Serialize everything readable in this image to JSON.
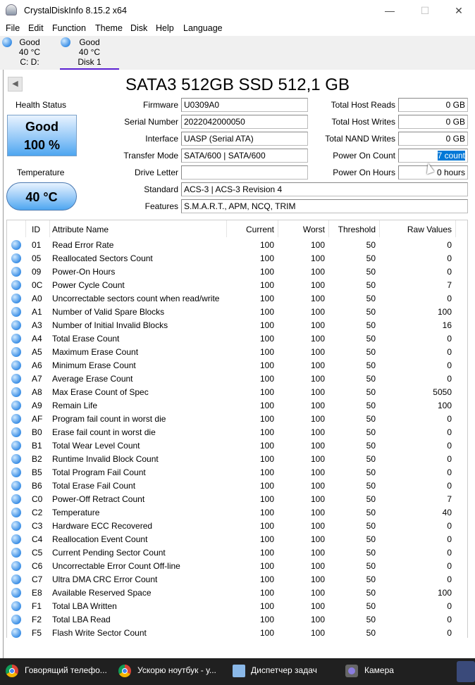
{
  "window": {
    "title": "CrystalDiskInfo 8.15.2 x64",
    "minimize": "—",
    "maximize": "☐",
    "close": "✕"
  },
  "menu": [
    "File",
    "Edit",
    "Function",
    "Theme",
    "Disk",
    "Help",
    "Language"
  ],
  "disk_tabs": [
    {
      "status": "Good",
      "temp": "40 °C",
      "name": "C: D:"
    },
    {
      "status": "Good",
      "temp": "40 °C",
      "name": "Disk 1"
    }
  ],
  "disk_title": "SATA3 512GB SSD 512,1 GB",
  "health": {
    "label": "Health Status",
    "status": "Good",
    "percent": "100 %"
  },
  "temperature": {
    "label": "Temperature",
    "value": "40 °C"
  },
  "info_left": [
    {
      "label": "Firmware",
      "value": "U0309A0"
    },
    {
      "label": "Serial Number",
      "value": "2022042000050"
    },
    {
      "label": "Interface",
      "value": "UASP (Serial ATA)"
    },
    {
      "label": "Transfer Mode",
      "value": "SATA/600 | SATA/600"
    },
    {
      "label": "Drive Letter",
      "value": ""
    }
  ],
  "info_right": [
    {
      "label": "Total Host Reads",
      "value": "0 GB"
    },
    {
      "label": "Total Host Writes",
      "value": "0 GB"
    },
    {
      "label": "Total NAND Writes",
      "value": "0 GB"
    },
    {
      "label": "Power On Count",
      "value": "7 count"
    },
    {
      "label": "Power On Hours",
      "value": "0 hours"
    }
  ],
  "standard": {
    "label": "Standard",
    "value": "ACS-3 | ACS-3 Revision 4"
  },
  "features": {
    "label": "Features",
    "value": "S.M.A.R.T., APM, NCQ, TRIM"
  },
  "table": {
    "headers": [
      "ID",
      "Attribute Name",
      "Current",
      "Worst",
      "Threshold",
      "Raw Values"
    ],
    "rows": [
      [
        "01",
        "Read Error Rate",
        "100",
        "100",
        "50",
        "0"
      ],
      [
        "05",
        "Reallocated Sectors Count",
        "100",
        "100",
        "50",
        "0"
      ],
      [
        "09",
        "Power-On Hours",
        "100",
        "100",
        "50",
        "0"
      ],
      [
        "0C",
        "Power Cycle Count",
        "100",
        "100",
        "50",
        "7"
      ],
      [
        "A0",
        "Uncorrectable sectors count when read/write",
        "100",
        "100",
        "50",
        "0"
      ],
      [
        "A1",
        "Number of Valid Spare Blocks",
        "100",
        "100",
        "50",
        "100"
      ],
      [
        "A3",
        "Number of Initial Invalid Blocks",
        "100",
        "100",
        "50",
        "16"
      ],
      [
        "A4",
        "Total Erase Count",
        "100",
        "100",
        "50",
        "0"
      ],
      [
        "A5",
        "Maximum Erase Count",
        "100",
        "100",
        "50",
        "0"
      ],
      [
        "A6",
        "Minimum Erase Count",
        "100",
        "100",
        "50",
        "0"
      ],
      [
        "A7",
        "Average Erase Count",
        "100",
        "100",
        "50",
        "0"
      ],
      [
        "A8",
        "Max Erase Count of Spec",
        "100",
        "100",
        "50",
        "5050"
      ],
      [
        "A9",
        "Remain Life",
        "100",
        "100",
        "50",
        "100"
      ],
      [
        "AF",
        "Program fail count in worst die",
        "100",
        "100",
        "50",
        "0"
      ],
      [
        "B0",
        "Erase fail count in worst die",
        "100",
        "100",
        "50",
        "0"
      ],
      [
        "B1",
        "Total Wear Level Count",
        "100",
        "100",
        "50",
        "0"
      ],
      [
        "B2",
        "Runtime Invalid Block Count",
        "100",
        "100",
        "50",
        "0"
      ],
      [
        "B5",
        "Total Program Fail Count",
        "100",
        "100",
        "50",
        "0"
      ],
      [
        "B6",
        "Total Erase Fail Count",
        "100",
        "100",
        "50",
        "0"
      ],
      [
        "C0",
        "Power-Off Retract Count",
        "100",
        "100",
        "50",
        "7"
      ],
      [
        "C2",
        "Temperature",
        "100",
        "100",
        "50",
        "40"
      ],
      [
        "C3",
        "Hardware ECC Recovered",
        "100",
        "100",
        "50",
        "0"
      ],
      [
        "C4",
        "Reallocation Event Count",
        "100",
        "100",
        "50",
        "0"
      ],
      [
        "C5",
        "Current Pending Sector Count",
        "100",
        "100",
        "50",
        "0"
      ],
      [
        "C6",
        "Uncorrectable Error Count Off-line",
        "100",
        "100",
        "50",
        "0"
      ],
      [
        "C7",
        "Ultra DMA CRC Error Count",
        "100",
        "100",
        "50",
        "0"
      ],
      [
        "E8",
        "Available Reserved Space",
        "100",
        "100",
        "50",
        "100"
      ],
      [
        "F1",
        "Total LBA Written",
        "100",
        "100",
        "50",
        "0"
      ],
      [
        "F2",
        "Total LBA Read",
        "100",
        "100",
        "50",
        "0"
      ],
      [
        "F5",
        "Flash Write Sector Count",
        "100",
        "100",
        "50",
        "0"
      ]
    ]
  },
  "taskbar": [
    "Говорящий телефо...",
    "Ускорю ноутбук - у...",
    "Диспетчер задач",
    "Камера"
  ],
  "colors": {
    "tab_underline": "#5a1fd1",
    "selection": "#0078d7",
    "taskbar": "#202020"
  }
}
